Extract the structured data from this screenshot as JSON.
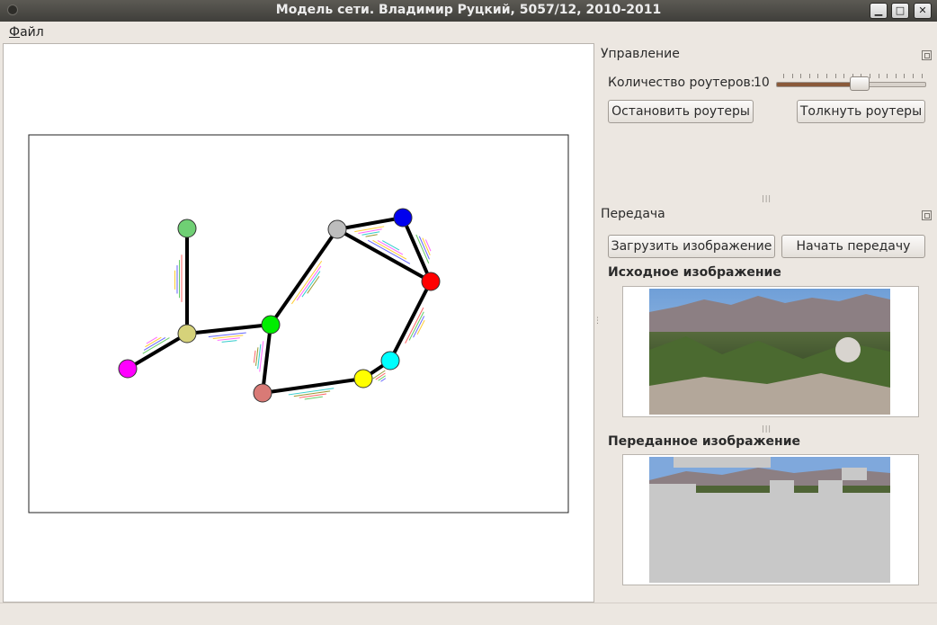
{
  "window": {
    "title": "Модель сети. Владимир Руцкий, 5057/12, 2010-2011",
    "controls": [
      "minimize-icon",
      "maximize-icon",
      "close-icon"
    ]
  },
  "menu": {
    "file_label": "Файл",
    "file_mnemonic": "Ф",
    "file_rest": "айл"
  },
  "control_dock": {
    "title": "Управление",
    "router_count_label": "Количество роутеров:",
    "router_count_value": "10",
    "slider_fraction": 0.56,
    "stop_button": "Остановить роутеры",
    "push_button": "Толкнуть роутеры"
  },
  "transfer_dock": {
    "title": "Передача",
    "load_button": "Загрузить изображение",
    "start_button": "Начать передачу",
    "source_label": "Исходное изображение",
    "received_label": "Переданное изображение"
  },
  "network": {
    "routers": [
      {
        "id": "green-light",
        "color": "#6fcf74"
      },
      {
        "id": "khaki",
        "color": "#d6d27a"
      },
      {
        "id": "magenta",
        "color": "#ff00ff"
      },
      {
        "id": "green",
        "color": "#00ee00"
      },
      {
        "id": "rose",
        "color": "#d97a76"
      },
      {
        "id": "gray",
        "color": "#bdbdbd"
      },
      {
        "id": "blue",
        "color": "#0000ee"
      },
      {
        "id": "red",
        "color": "#ff0000"
      },
      {
        "id": "cyan",
        "color": "#00ffff"
      },
      {
        "id": "yellow",
        "color": "#ffff00"
      }
    ],
    "links": [
      [
        "green-light",
        "khaki"
      ],
      [
        "khaki",
        "magenta"
      ],
      [
        "khaki",
        "green"
      ],
      [
        "green",
        "gray"
      ],
      [
        "green",
        "rose"
      ],
      [
        "rose",
        "yellow"
      ],
      [
        "yellow",
        "cyan"
      ],
      [
        "cyan",
        "red"
      ],
      [
        "red",
        "blue"
      ],
      [
        "red",
        "gray"
      ],
      [
        "gray",
        "blue"
      ]
    ]
  },
  "colors": {
    "titlebar": "#3f3e3a",
    "window_bg": "#ece7e1",
    "placeholder_gray": "#c8c8c8"
  }
}
